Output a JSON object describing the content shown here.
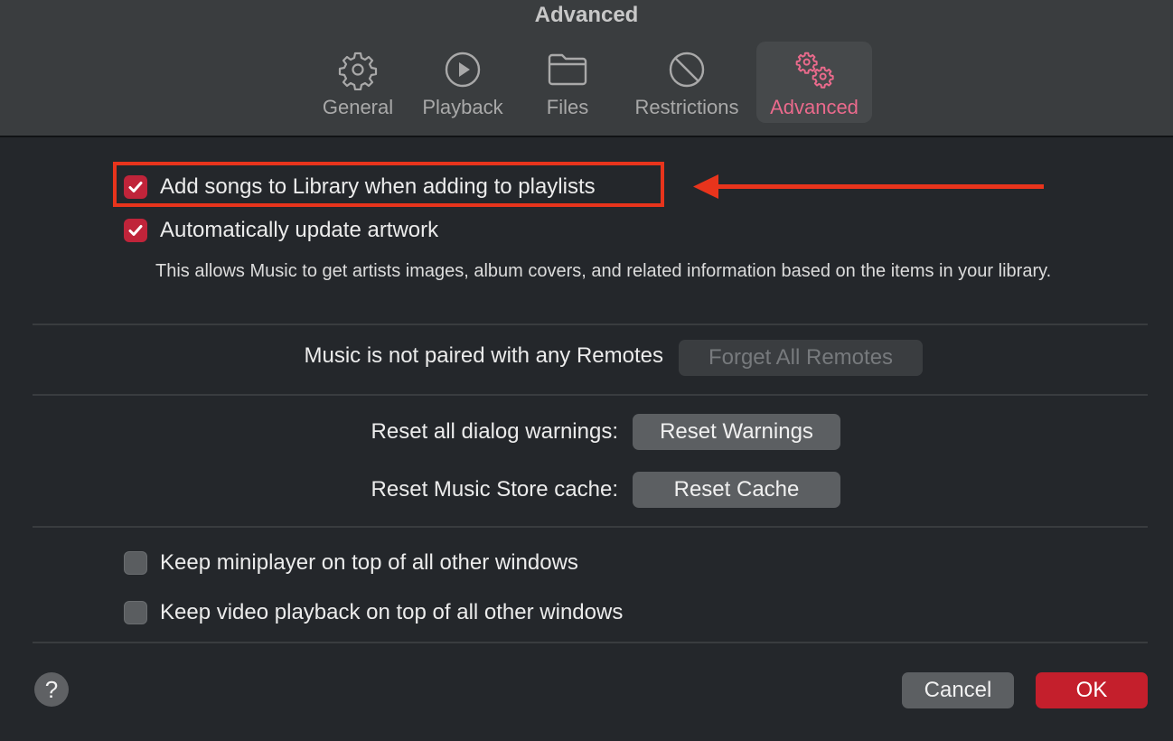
{
  "window": {
    "title": "Advanced"
  },
  "tabs": [
    {
      "label": "General",
      "icon": "gear-icon",
      "active": false
    },
    {
      "label": "Playback",
      "icon": "play-circle-icon",
      "active": false
    },
    {
      "label": "Files",
      "icon": "folder-icon",
      "active": false
    },
    {
      "label": "Restrictions",
      "icon": "prohibited-icon",
      "active": false
    },
    {
      "label": "Advanced",
      "icon": "gears-icon",
      "active": true
    }
  ],
  "options": {
    "add_songs": {
      "label": "Add songs to Library when adding to playlists",
      "checked": true
    },
    "update_artwork": {
      "label": "Automatically update artwork",
      "checked": true
    },
    "artwork_description": "This allows Music to get artists images, album covers, and related information based on the items in your library.",
    "keep_miniplayer": {
      "label": "Keep miniplayer on top of all other windows",
      "checked": false
    },
    "keep_video": {
      "label": "Keep video playback on top of all other windows",
      "checked": false
    }
  },
  "remotes": {
    "status": "Music is not paired with any Remotes",
    "forget_button": "Forget All Remotes",
    "forget_enabled": false
  },
  "resets": {
    "warnings_label": "Reset all dialog warnings:",
    "warnings_button": "Reset Warnings",
    "cache_label": "Reset Music Store cache:",
    "cache_button": "Reset Cache"
  },
  "footer": {
    "help": "?",
    "cancel": "Cancel",
    "ok": "OK"
  },
  "annotation": {
    "color": "#e8341c",
    "target": "add_songs"
  },
  "colors": {
    "accent": "#ea6a8c",
    "checkbox": "#c0243a",
    "ok_button": "#c41f2c"
  }
}
